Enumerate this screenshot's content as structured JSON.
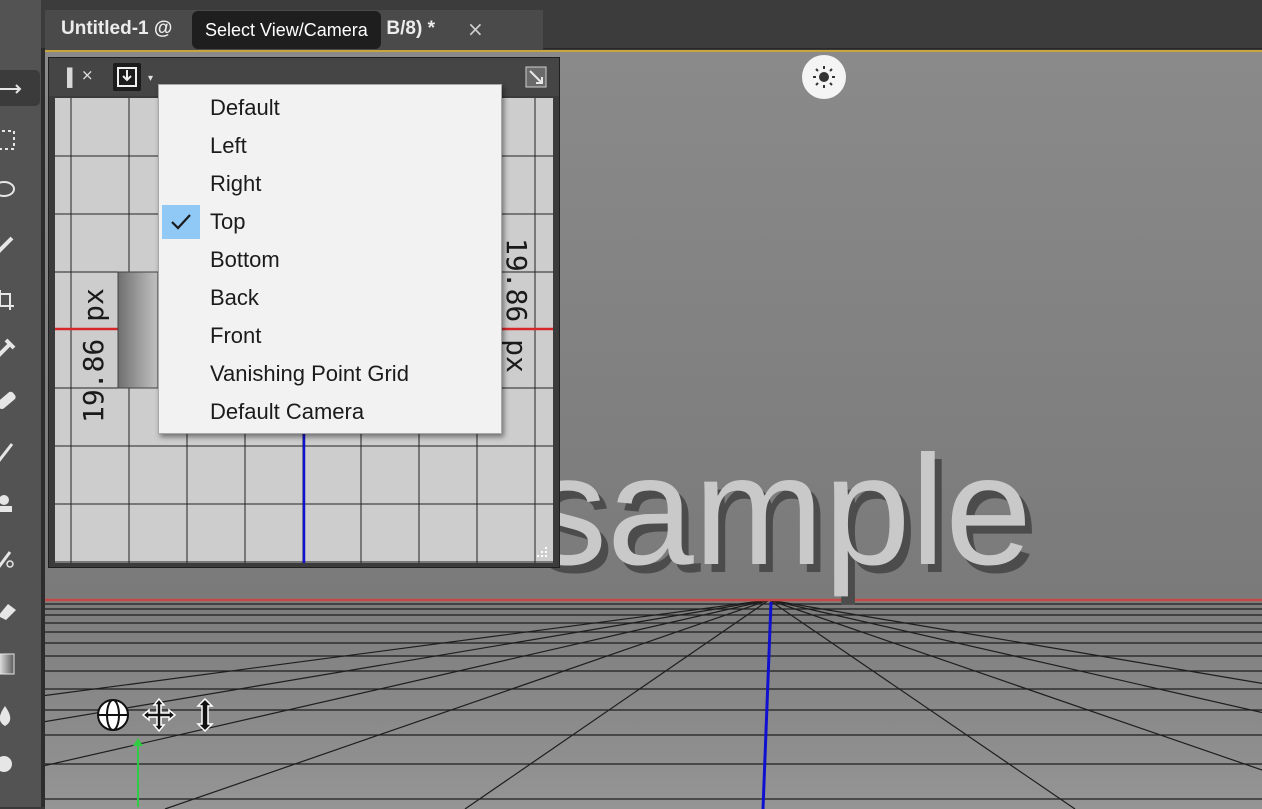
{
  "document": {
    "tab_title": "Untitled-1 @",
    "tab_title_tail": "B/8) *",
    "close_glyph": "×"
  },
  "tooltip": {
    "text": "Select View/Camera"
  },
  "view_menu": {
    "items": [
      {
        "label": "Default",
        "checked": false
      },
      {
        "label": "Left",
        "checked": false
      },
      {
        "label": "Right",
        "checked": false
      },
      {
        "label": "Top",
        "checked": true
      },
      {
        "label": "Bottom",
        "checked": false
      },
      {
        "label": "Back",
        "checked": false
      },
      {
        "label": "Front",
        "checked": false
      },
      {
        "label": "Vanishing Point Grid",
        "checked": false
      },
      {
        "label": "Default Camera",
        "checked": false
      }
    ],
    "check_color": "#90c8f6"
  },
  "minimap": {
    "dimension_left": "19.86 px",
    "dimension_right": "19.86 px"
  },
  "scene": {
    "text_3d": "sample"
  },
  "panel": {
    "close_glyph": "×",
    "caret_glyph": "▾"
  },
  "colors": {
    "selection_frame": "#c8a43c",
    "x_axis": "#d62828",
    "z_axis": "#1010d0",
    "y_axis": "#2ecc40"
  },
  "icons": {
    "toolbar": [
      "move-tool-icon",
      "marquee-tool-icon",
      "lasso-tool-icon",
      "quick-select-tool-icon",
      "crop-tool-icon",
      "eyedropper-tool-icon",
      "healing-brush-tool-icon",
      "brush-tool-icon",
      "clone-stamp-tool-icon",
      "history-brush-tool-icon",
      "eraser-tool-icon",
      "gradient-tool-icon",
      "blur-tool-icon",
      "dodge-tool-icon"
    ],
    "scene": [
      "light-icon",
      "orbit-icon",
      "pan-icon",
      "dolly-icon"
    ]
  }
}
